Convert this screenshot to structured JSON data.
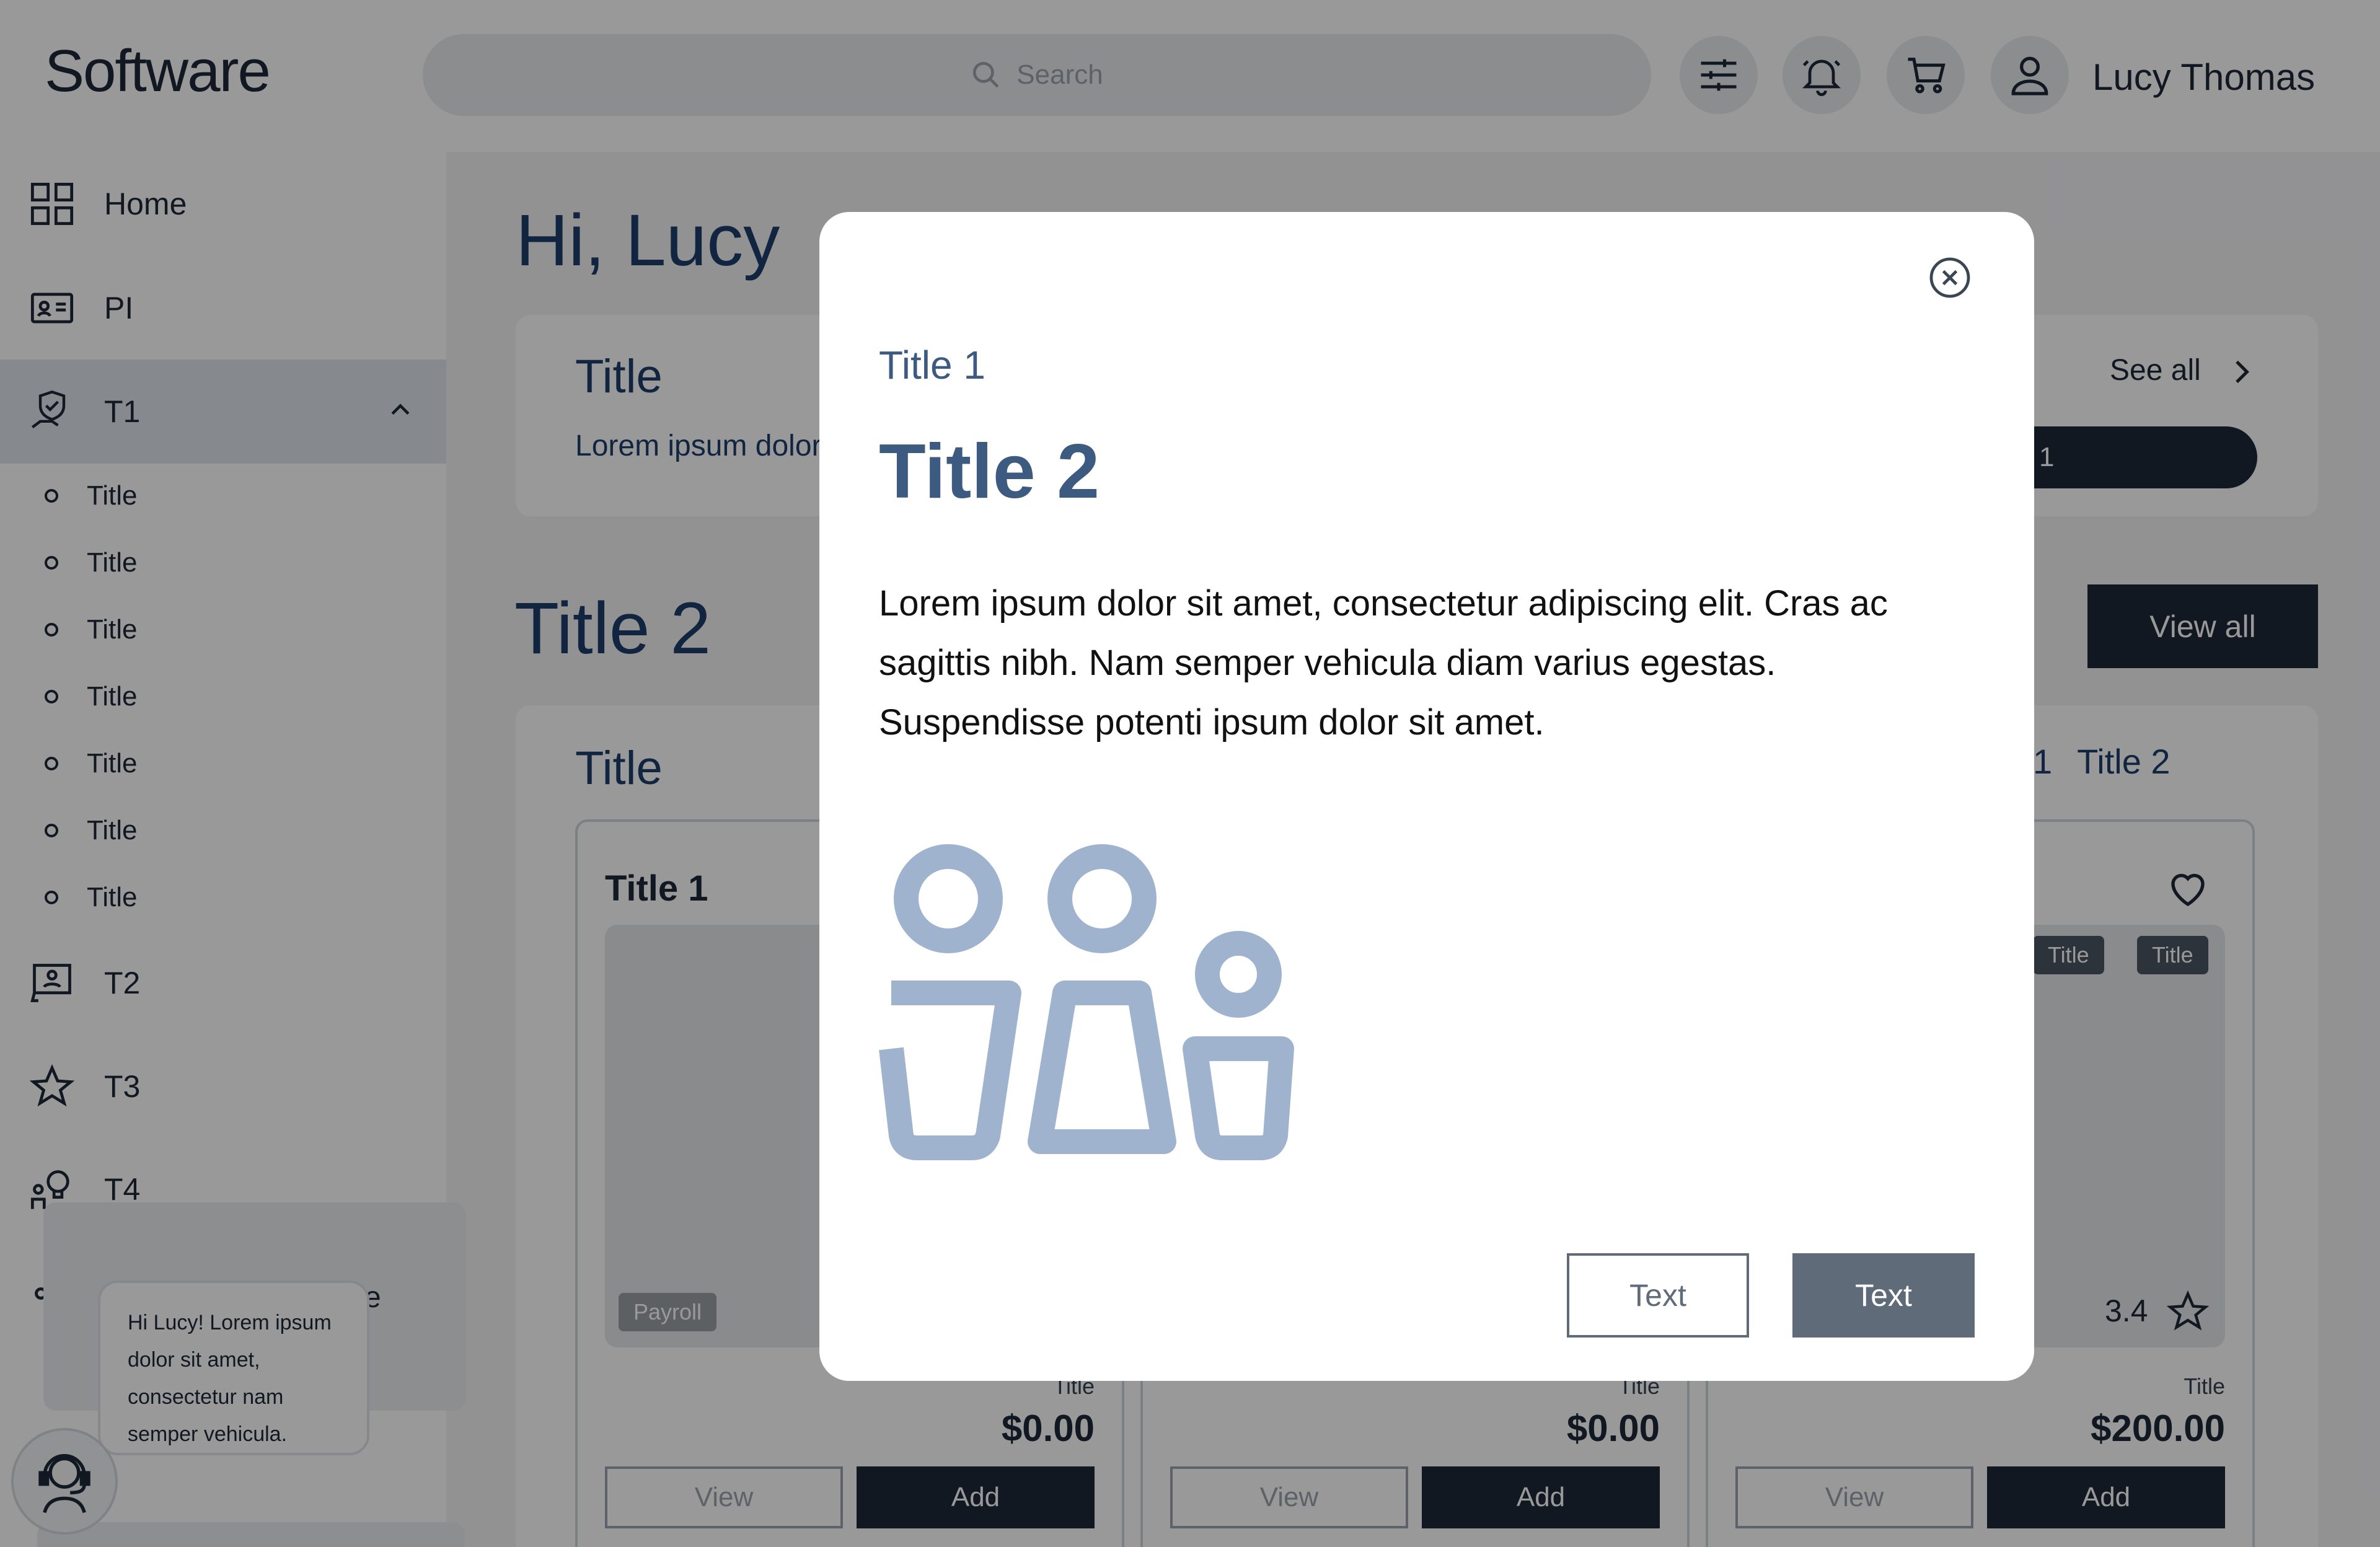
{
  "header": {
    "brand": "Software",
    "search_placeholder": "Search",
    "user_name": "Lucy Thomas"
  },
  "sidebar": {
    "items": [
      {
        "label": "Home",
        "icon": "grid-icon"
      },
      {
        "label": "PI",
        "icon": "id-card-icon"
      },
      {
        "label": "T1",
        "icon": "hand-shield-icon",
        "expanded": true
      },
      {
        "label": "T2",
        "icon": "person-board-icon"
      },
      {
        "label": "T3",
        "icon": "star-icon"
      },
      {
        "label": "T4",
        "icon": "person-idea-icon"
      }
    ],
    "sub_items": [
      "Title",
      "Title",
      "Title",
      "Title",
      "Title",
      "Title",
      "Title"
    ],
    "share_partial_label": "e"
  },
  "main": {
    "greeting": "Hi, Lucy",
    "top_card": {
      "title": "Title",
      "text": "Lorem ipsum dolor",
      "see_all": "See all",
      "pill_text": "1"
    },
    "section_title": "Title 2",
    "view_all": "View all",
    "products_card": {
      "title": "Title",
      "tab_links": [
        "1",
        "Title 2"
      ]
    },
    "products": [
      {
        "title": "Title 1",
        "badge": "Payroll",
        "small": "Title",
        "price": "$0.00",
        "view": "View",
        "add": "Add"
      },
      {
        "title": "",
        "small": "Title",
        "price": "$0.00",
        "view": "View",
        "add": "Add"
      },
      {
        "title": "",
        "tags": [
          "Title",
          "Title"
        ],
        "rating": "3.4",
        "small": "Title",
        "price": "$200.00",
        "view": "View",
        "add": "Add"
      }
    ]
  },
  "chat": {
    "message": "Hi Lucy! Lorem ipsum dolor sit amet, consectetur nam semper vehicula."
  },
  "modal": {
    "title1": "Title 1",
    "title2": "Title 2",
    "body": "Lorem ipsum dolor sit amet, consectetur adipiscing elit. Cras ac sagittis nibh. Nam semper vehicula diam varius egestas. Suspendisse potenti ipsum dolor sit amet.",
    "secondary_button": "Text",
    "primary_button": "Text",
    "illustration": "family-icon",
    "illustration_color": "#a0b3ce"
  }
}
